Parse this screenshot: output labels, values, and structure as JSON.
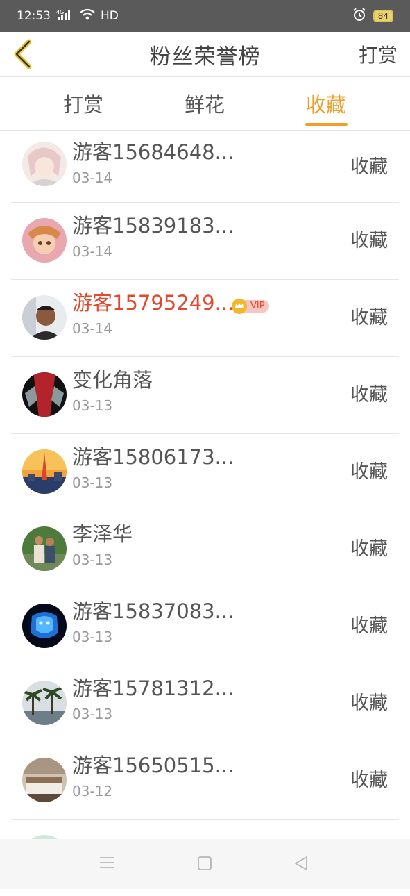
{
  "status": {
    "time": "12:53",
    "network": "4G",
    "hd": "HD",
    "battery": "84"
  },
  "header": {
    "title": "粉丝荣誉榜",
    "right_action": "打赏",
    "back_icon": "chevron-left-icon"
  },
  "tabs": [
    {
      "label": "打赏",
      "active": false
    },
    {
      "label": "鲜花",
      "active": false
    },
    {
      "label": "收藏",
      "active": true
    }
  ],
  "accent_color": "#f0a02a",
  "vip_name_color": "#e0492e",
  "items": [
    {
      "name": "游客15684648...",
      "date": "03-14",
      "action": "收藏",
      "vip": false
    },
    {
      "name": "游客15839183...",
      "date": "03-14",
      "action": "收藏",
      "vip": false
    },
    {
      "name": "游客15795249...",
      "date": "03-14",
      "action": "收藏",
      "vip": true,
      "vip_label": "VIP"
    },
    {
      "name": "变化角落",
      "date": "03-13",
      "action": "收藏",
      "vip": false
    },
    {
      "name": "游客15806173...",
      "date": "03-13",
      "action": "收藏",
      "vip": false
    },
    {
      "name": "李泽华",
      "date": "03-13",
      "action": "收藏",
      "vip": false
    },
    {
      "name": "游客15837083...",
      "date": "03-13",
      "action": "收藏",
      "vip": false
    },
    {
      "name": "游客15781312...",
      "date": "03-13",
      "action": "收藏",
      "vip": false
    },
    {
      "name": "游客15650515...",
      "date": "03-12",
      "action": "收藏",
      "vip": false
    }
  ]
}
